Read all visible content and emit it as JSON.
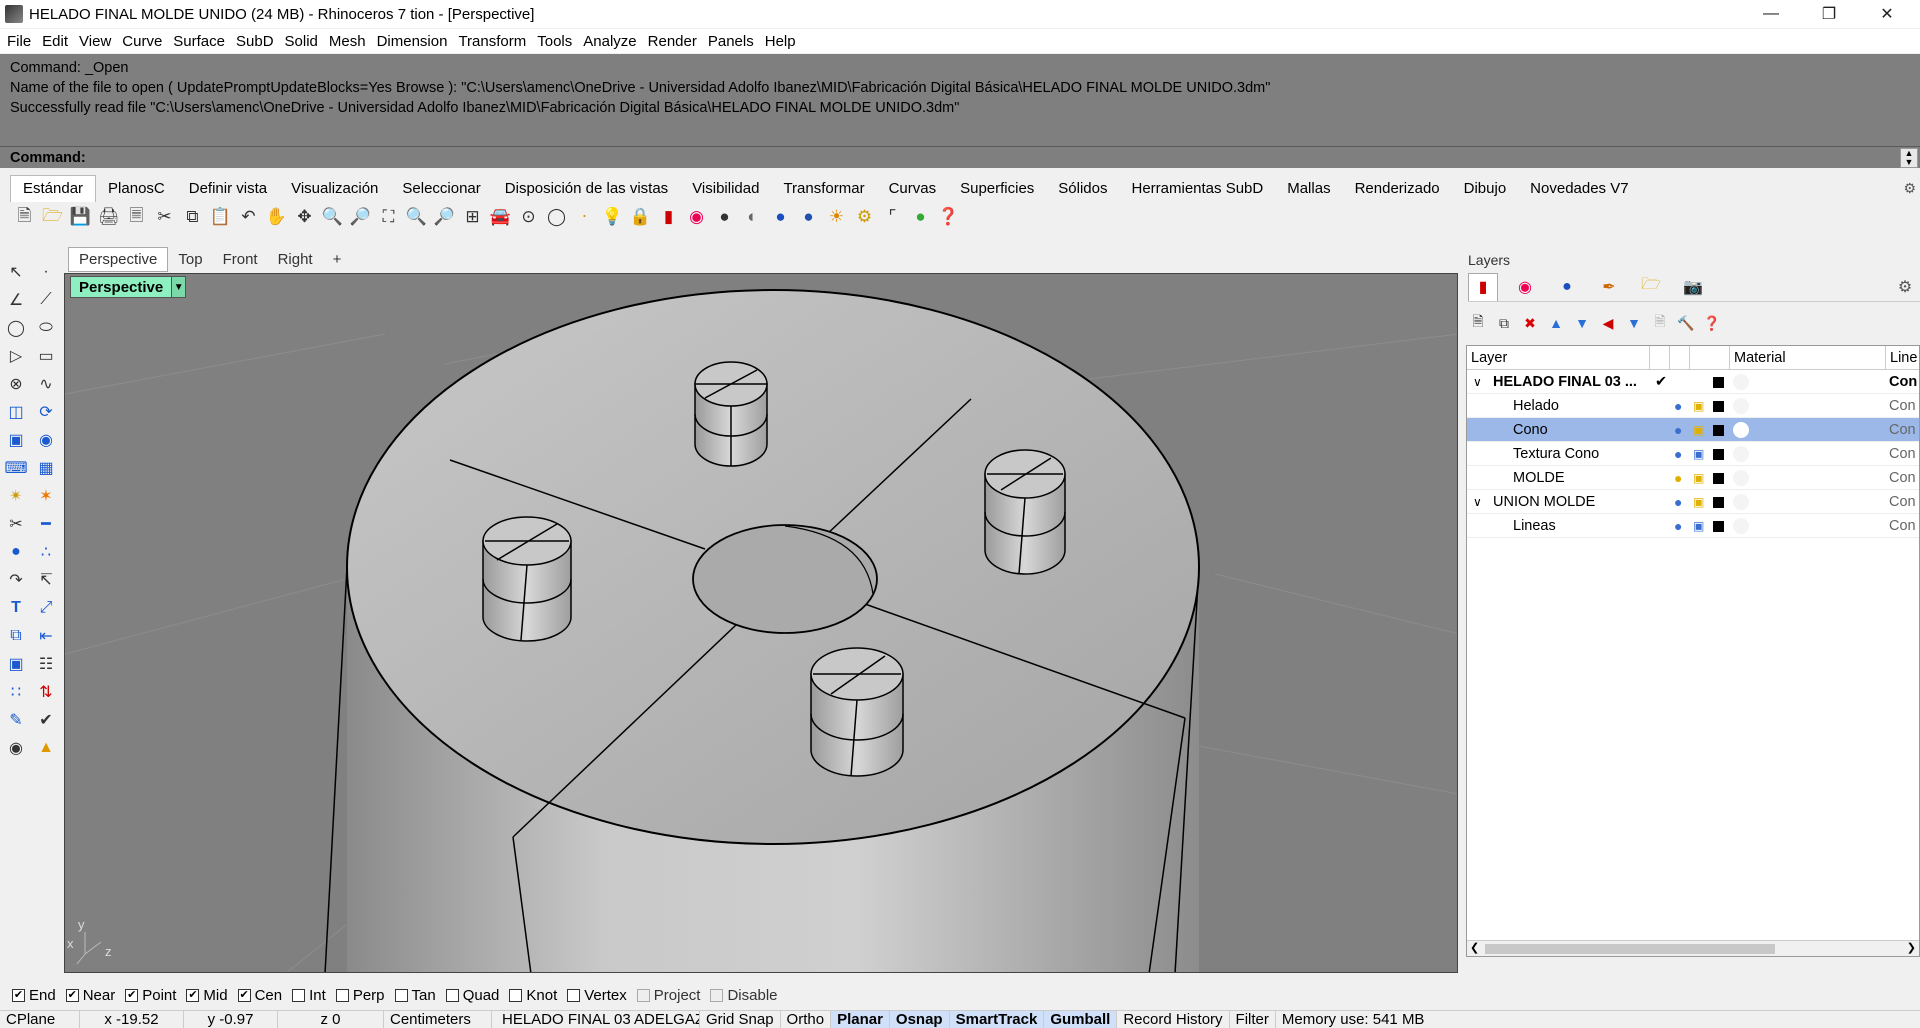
{
  "window": {
    "title": "HELADO FINAL MOLDE UNIDO (24 MB) - Rhinoceros 7 tion - [Perspective]"
  },
  "menu": [
    "File",
    "Edit",
    "View",
    "Curve",
    "Surface",
    "SubD",
    "Solid",
    "Mesh",
    "Dimension",
    "Transform",
    "Tools",
    "Analyze",
    "Render",
    "Panels",
    "Help"
  ],
  "command_history": [
    "Command: _Open",
    "Name of the file to open ( UpdatePromptUpdateBlocks=Yes  Browse ): \"C:\\Users\\amenc\\OneDrive - Universidad Adolfo Ibanez\\MID\\Fabricación Digital Básica\\HELADO FINAL MOLDE UNIDO.3dm\"",
    "Successfully read file \"C:\\Users\\amenc\\OneDrive - Universidad Adolfo Ibanez\\MID\\Fabricación Digital Básica\\HELADO FINAL MOLDE UNIDO.3dm\""
  ],
  "command_prompt": "Command:",
  "toolbar_tabs": [
    "Estándar",
    "PlanosC",
    "Definir vista",
    "Visualización",
    "Seleccionar",
    "Disposición de las vistas",
    "Visibilidad",
    "Transformar",
    "Curvas",
    "Superficies",
    "Sólidos",
    "Herramientas SubD",
    "Mallas",
    "Renderizado",
    "Dibujo",
    "Novedades V7"
  ],
  "toolbar_active_tab": "Estándar",
  "viewport_tabs": [
    "Perspective",
    "Top",
    "Front",
    "Right",
    "+"
  ],
  "viewport_label": "Perspective",
  "axis_labels": {
    "x": "x",
    "y": "y",
    "z": "z"
  },
  "layers_panel": {
    "title": "Layers",
    "columns": {
      "layer": "Layer",
      "material": "Material",
      "linetype": "Line"
    },
    "rows": [
      {
        "name": "HELADO FINAL 03 ...",
        "indent": 0,
        "bold": true,
        "expanded": true,
        "current": true,
        "selected": false,
        "bulb": "none",
        "lock": "none",
        "linetype": "Con"
      },
      {
        "name": "Helado",
        "indent": 1,
        "bold": false,
        "selected": false,
        "bulb": "blue",
        "lock": "open",
        "linetype": "Con"
      },
      {
        "name": "Cono",
        "indent": 1,
        "bold": false,
        "selected": true,
        "bulb": "blue",
        "lock": "open",
        "linetype": "Con"
      },
      {
        "name": "Textura Cono",
        "indent": 1,
        "bold": false,
        "selected": false,
        "bulb": "blue",
        "lock": "closed",
        "linetype": "Con"
      },
      {
        "name": "MOLDE",
        "indent": 1,
        "bold": false,
        "selected": false,
        "bulb": "yellow",
        "lock": "open",
        "linetype": "Con"
      },
      {
        "name": "UNION MOLDE",
        "indent": 0,
        "bold": false,
        "expanded": true,
        "selected": false,
        "bulb": "blue",
        "lock": "open",
        "linetype": "Con"
      },
      {
        "name": "Lineas",
        "indent": 1,
        "bold": false,
        "selected": false,
        "bulb": "blue",
        "lock": "closed",
        "linetype": "Con"
      }
    ]
  },
  "osnaps": [
    {
      "label": "End",
      "checked": true
    },
    {
      "label": "Near",
      "checked": true
    },
    {
      "label": "Point",
      "checked": true
    },
    {
      "label": "Mid",
      "checked": true
    },
    {
      "label": "Cen",
      "checked": true
    },
    {
      "label": "Int",
      "checked": false
    },
    {
      "label": "Perp",
      "checked": false
    },
    {
      "label": "Tan",
      "checked": false
    },
    {
      "label": "Quad",
      "checked": false
    },
    {
      "label": "Knot",
      "checked": false
    },
    {
      "label": "Vertex",
      "checked": false
    },
    {
      "label": "Project",
      "checked": false,
      "disabled": true
    },
    {
      "label": "Disable",
      "checked": false,
      "disabled": true
    }
  ],
  "status_bar": {
    "cplane": "CPlane",
    "x": "x -19.52",
    "y": "y -0.97",
    "z": "z 0",
    "units": "Centimeters",
    "layer": "HELADO FINAL 03 ADELGAZ",
    "toggles": [
      {
        "label": "Grid Snap",
        "on": false
      },
      {
        "label": "Ortho",
        "on": false
      },
      {
        "label": "Planar",
        "on": true
      },
      {
        "label": "Osnap",
        "on": true
      },
      {
        "label": "SmartTrack",
        "on": true
      },
      {
        "label": "Gumball",
        "on": true
      },
      {
        "label": "Record History",
        "on": false
      },
      {
        "label": "Filter",
        "on": false
      }
    ],
    "memory": "Memory use: 541 MB"
  },
  "colors": {
    "viewport_bg": "#808080",
    "viewport_label_bg": "#8ef0c0",
    "layer_selected": "#9bb8e8",
    "command_bg": "#7f7f7f"
  }
}
